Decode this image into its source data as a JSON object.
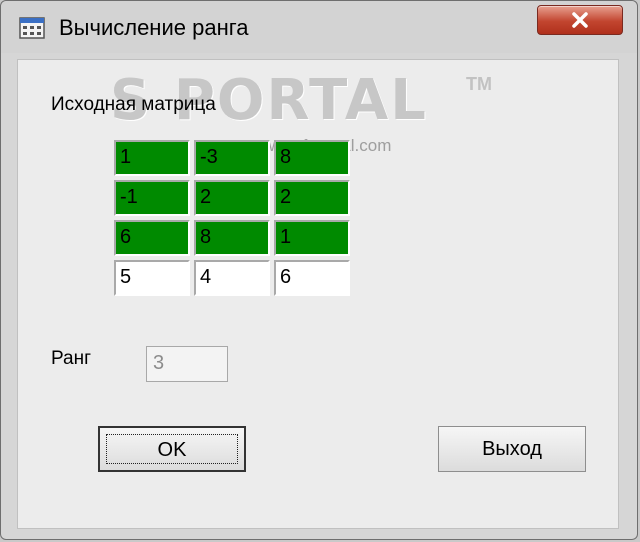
{
  "window": {
    "title": "Вычисление ранга",
    "icon": "calculator-icon",
    "close_icon": "close-icon"
  },
  "watermark": {
    "main": "S    PORTAL",
    "tm": "TM",
    "sub": "www.softportal.com"
  },
  "matrix": {
    "label": "Исходная матрица",
    "rows": [
      [
        "1",
        "-3",
        "8"
      ],
      [
        "-1",
        "2",
        "2"
      ],
      [
        "6",
        "8",
        "1"
      ],
      [
        "5",
        "4",
        "6"
      ]
    ],
    "highlight_color": "#008a00"
  },
  "rank": {
    "label": "Ранг",
    "value": "3"
  },
  "buttons": {
    "ok": "OK",
    "exit": "Выход"
  }
}
